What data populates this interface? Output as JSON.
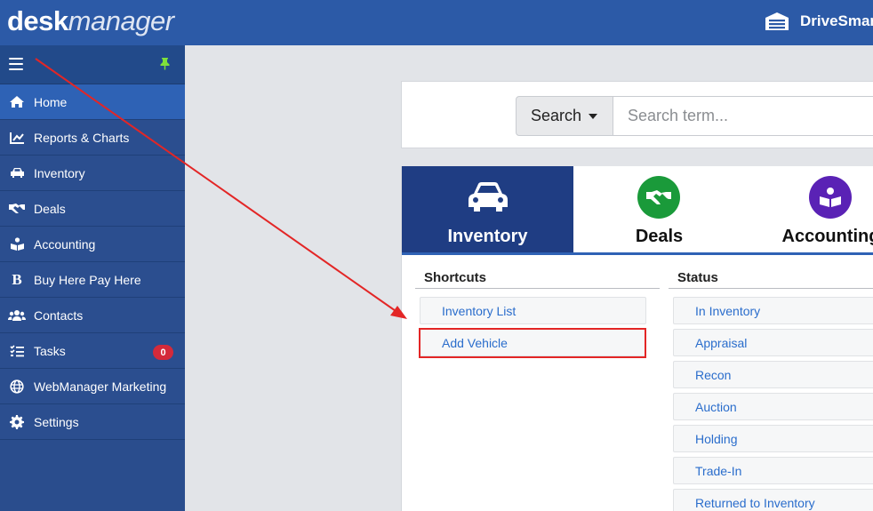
{
  "header": {
    "logo_bold": "desk",
    "logo_italic": "manager",
    "brand": "DriveSmar"
  },
  "sidebar": {
    "items": [
      {
        "label": "Home",
        "icon": "home-icon",
        "active": true
      },
      {
        "label": "Reports & Charts",
        "icon": "chart-line-icon"
      },
      {
        "label": "Inventory",
        "icon": "car-icon"
      },
      {
        "label": "Deals",
        "icon": "handshake-icon"
      },
      {
        "label": "Accounting",
        "icon": "accounting-icon"
      },
      {
        "label": "Buy Here Pay Here",
        "icon": "bitcoin-b-icon"
      },
      {
        "label": "Contacts",
        "icon": "users-icon"
      },
      {
        "label": "Tasks",
        "icon": "tasks-icon",
        "badge": "0"
      },
      {
        "label": "WebManager Marketing",
        "icon": "globe-icon"
      },
      {
        "label": "Settings",
        "icon": "gear-icon"
      }
    ]
  },
  "search": {
    "button_label": "Search",
    "placeholder": "Search term..."
  },
  "tabs": [
    {
      "label": "Inventory",
      "icon": "car-icon"
    },
    {
      "label": "Deals",
      "icon": "handshake-icon",
      "color": "#1a9a3a"
    },
    {
      "label": "Accounting",
      "icon": "accounting-icon",
      "color": "#5a22b5"
    }
  ],
  "shortcuts": {
    "heading": "Shortcuts",
    "items": [
      "Inventory List",
      "Add Vehicle"
    ]
  },
  "status": {
    "heading": "Status",
    "items": [
      "In Inventory",
      "Appraisal",
      "Recon",
      "Auction",
      "Holding",
      "Trade-In",
      "Returned to Inventory"
    ]
  },
  "colors": {
    "accent": "#2c5aa7",
    "link": "#2a6dcc",
    "highlight": "#e32626"
  }
}
